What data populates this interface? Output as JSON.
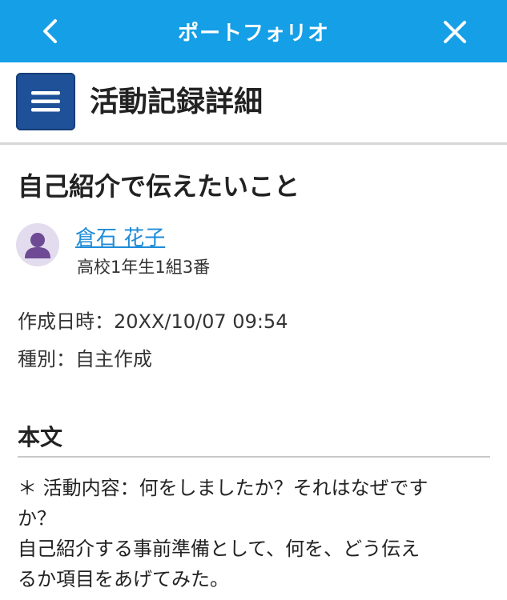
{
  "topbar": {
    "title": "ポートフォリオ",
    "back_icon": "chevron-left-icon",
    "close_icon": "close-icon",
    "background_color": "#159fe6"
  },
  "header": {
    "menu_icon": "hamburger-menu-icon",
    "title": "活動記録詳細",
    "menu_color": "#1f5199"
  },
  "entry": {
    "title": "自己紹介で伝えたいこと",
    "author": {
      "name": "倉石 花子",
      "class": "高校1年生1組3番",
      "avatar_icon": "person-icon"
    },
    "created": "作成日時：20XX/10/07 09:54",
    "type": "種別：自主作成",
    "body_heading": "本文",
    "body_lines": [
      "＊ 活動内容：何をしましたか？それはなぜです",
      "か？",
      "自己紹介する事前準備として、何を、どう伝え",
      "るか項目をあげてみた。"
    ]
  }
}
